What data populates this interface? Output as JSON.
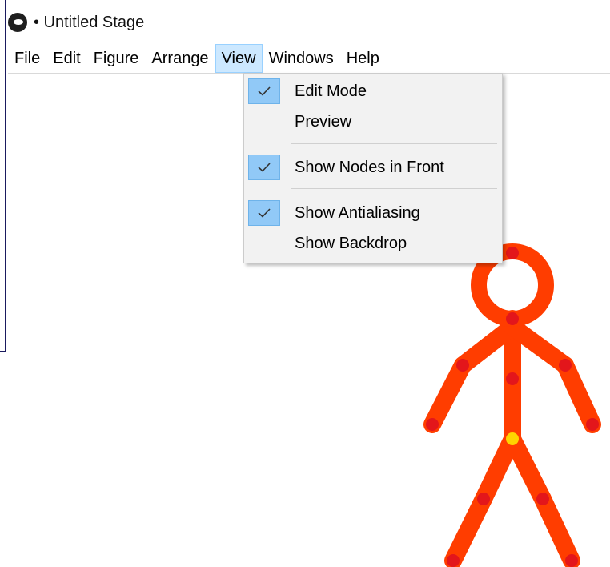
{
  "window": {
    "title": "• Untitled Stage",
    "icon": "app-logo-icon"
  },
  "menubar": {
    "items": [
      {
        "label": "File"
      },
      {
        "label": "Edit"
      },
      {
        "label": "Figure"
      },
      {
        "label": "Arrange"
      },
      {
        "label": "View",
        "active": true
      },
      {
        "label": "Windows"
      },
      {
        "label": "Help"
      }
    ]
  },
  "view_menu": {
    "items": [
      {
        "label": "Edit Mode",
        "checked": true
      },
      {
        "label": "Preview",
        "checked": false
      },
      {
        "label": "Show Nodes in Front",
        "checked": true
      },
      {
        "label": "Show Antialiasing",
        "checked": true
      },
      {
        "label": "Show Backdrop",
        "checked": false
      }
    ],
    "check_icon": "checkmark-icon"
  },
  "stage": {
    "figure": {
      "limb_color": "#ff3d00",
      "node_color": "#e3161b",
      "origin_node_color": "#ffd400",
      "icon": "stick-figure"
    }
  },
  "colors": {
    "menu_highlight": "#cce8ff",
    "check_background": "#91c9f7",
    "menu_background": "#f2f2f2"
  }
}
